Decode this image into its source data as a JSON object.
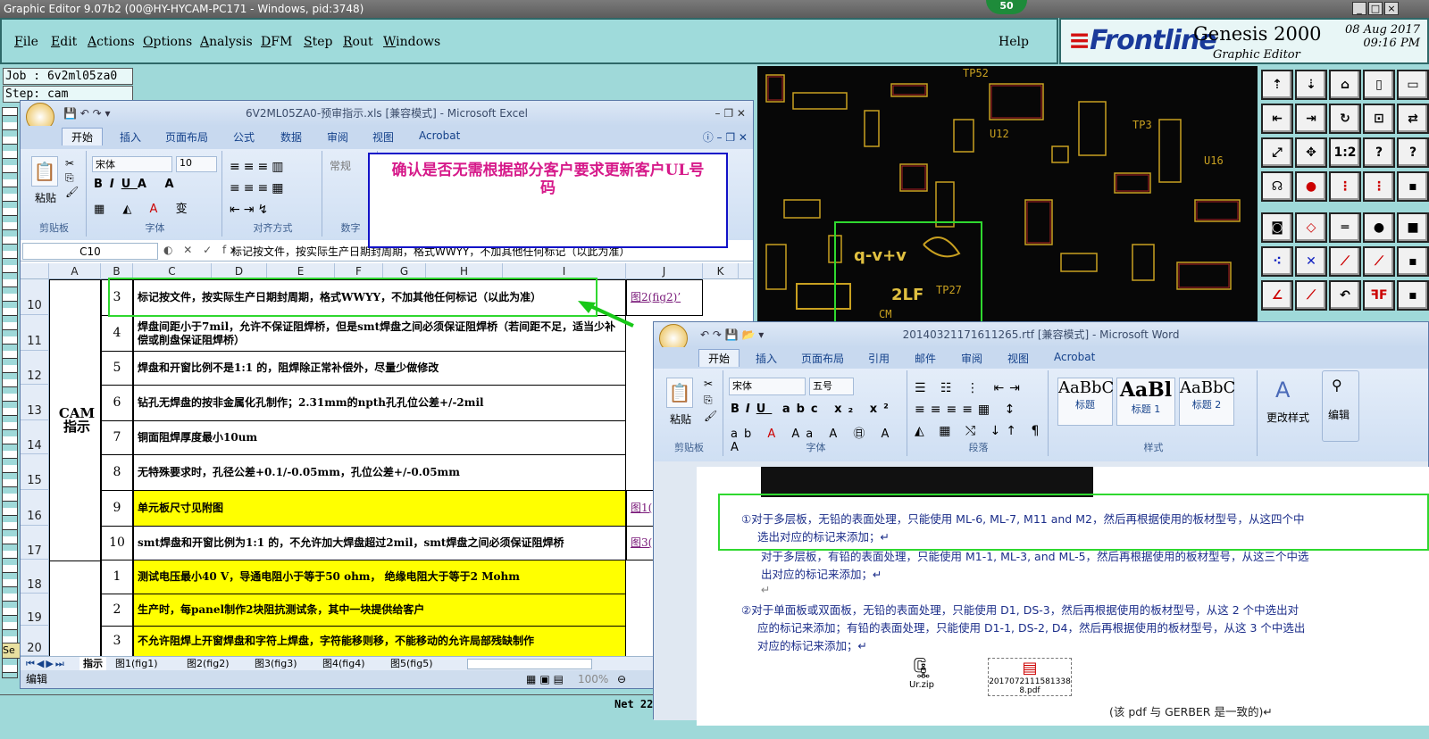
{
  "genesis": {
    "title": "Graphic Editor 9.07b2 (00@HY-HYCAM-PC171 - Windows, pid:3748)",
    "badge": "50",
    "menu": [
      {
        "label": "File",
        "u": "F",
        "rest": "ile"
      },
      {
        "label": "Edit",
        "u": "E",
        "rest": "dit"
      },
      {
        "label": "Actions",
        "u": "A",
        "rest": "ctions"
      },
      {
        "label": "Options",
        "u": "O",
        "rest": "ptions"
      },
      {
        "label": "Analysis",
        "u": "A",
        "rest": "nalysis"
      },
      {
        "label": "DFM",
        "u": "D",
        "rest": "FM"
      },
      {
        "label": "Step",
        "u": "S",
        "rest": "tep"
      },
      {
        "label": "Rout",
        "u": "R",
        "rest": "out"
      },
      {
        "label": "Windows",
        "u": "W",
        "rest": "indows"
      }
    ],
    "help": "Help",
    "logo_frontline": "Frontline",
    "product": "Genesis 2000",
    "subtitle": "Graphic Editor",
    "date": "08 Aug 2017",
    "time": "09:16 PM",
    "job": "Job : 6v2ml05za0",
    "step": "Step: cam",
    "net": "Net 22",
    "left_tab": "Se",
    "board_labels": [
      "TP52",
      "U12",
      "TP3",
      "U16",
      "TP27",
      "2LF",
      "q-v+v",
      "C100",
      "CM"
    ]
  },
  "excel": {
    "title": "6V2ML05ZA0-预审指示.xls  [兼容模式] - Microsoft Excel",
    "tabs": [
      "开始",
      "插入",
      "页面布局",
      "公式",
      "数据",
      "审阅",
      "视图",
      "Acrobat"
    ],
    "groups": {
      "clipboard": "剪贴板",
      "paste": "粘贴",
      "font": "字体",
      "font_name": "宋体",
      "font_size": "10",
      "alignment": "对齐方式",
      "number": "数字",
      "number_format": "常规"
    },
    "name_box": "C10",
    "formula": "标记按文件，按实际生产日期封周期，格式WWYY，不加其他任何标记（以此为准）",
    "columns": [
      "A",
      "B",
      "C",
      "D",
      "E",
      "F",
      "G",
      "H",
      "I",
      "J",
      "K"
    ],
    "section_label": "CAM\n指示",
    "rows": [
      {
        "row": "10",
        "n": "3",
        "text": "标记按文件，按实际生产日期封周期，格式WWYY，不加其他任何标记（以此为准）",
        "link": "图2(fig2)’",
        "yellow": false
      },
      {
        "row": "11",
        "n": "4",
        "text": "焊盘间距小于7mil，允许不保证阻焊桥，但是smt焊盘之间必须保证阻焊桥（若间距不足，适当少补偿或削盘保证阻焊桥）",
        "link": "",
        "yellow": false
      },
      {
        "row": "12",
        "n": "5",
        "text": "焊盘和开窗比例不是1:1 的，阻焊除正常补偿外，尽量少做修改",
        "link": "",
        "yellow": false
      },
      {
        "row": "13",
        "n": "6",
        "text": "钻孔无焊盘的按非金属化孔制作；2.31mm的npth孔孔位公差+/-2mil",
        "link": "",
        "yellow": false
      },
      {
        "row": "14",
        "n": "7",
        "text": "铜面阻焊厚度最小10um",
        "link": "",
        "yellow": false
      },
      {
        "row": "15",
        "n": "8",
        "text": "无特殊要求时，孔径公差+0.1/-0.05mm，孔位公差+/-0.05mm",
        "link": "",
        "yellow": false
      },
      {
        "row": "16",
        "n": "9",
        "text": "单元板尺寸见附图",
        "link": "图1(",
        "yellow": true
      },
      {
        "row": "17",
        "n": "10",
        "text": "smt焊盘和开窗比例为1:1 的，不允许加大焊盘超过2mil，smt焊盘之间必须保证阻焊桥",
        "link": "图3(",
        "yellow": false
      },
      {
        "row": "18",
        "n": "1",
        "text": "测试电压最小40 V，导通电阻小于等于50 ohm， 绝缘电阻大于等于2 Mohm",
        "link": "",
        "yellow": true
      },
      {
        "row": "19",
        "n": "2",
        "text": "生产时，每panel制作2块阻抗测试条，其中一块提供给客户",
        "link": "",
        "yellow": true
      },
      {
        "row": "20",
        "n": "3",
        "text": "不允许阻焊上开窗焊盘和字符上焊盘，字符能移则移，不能移动的允许局部残缺制作",
        "link": "",
        "yellow": true
      }
    ],
    "sheets": [
      "指示",
      "图1(fig1)",
      "图2(fig2)",
      "图3(fig3)",
      "图4(fig4)",
      "图5(fig5)"
    ],
    "status": "编辑",
    "zoom": "100%"
  },
  "callout": "确认是否无需根据部分客户要求更新客户UL号码",
  "word": {
    "title": "20140321171611265.rtf [兼容模式] - Microsoft Word",
    "tabs": [
      "开始",
      "插入",
      "页面布局",
      "引用",
      "邮件",
      "审阅",
      "视图",
      "Acrobat"
    ],
    "groups": {
      "clipboard": "剪贴板",
      "paste": "粘贴",
      "font": "字体",
      "font_name": "宋体",
      "font_size": "五号",
      "paragraph": "段落",
      "styles": "样式",
      "change_styles": "更改样式",
      "edit": "编辑"
    },
    "styles": [
      {
        "preview": "AaBbC",
        "name": "标题"
      },
      {
        "preview": "AaBl",
        "name": "标题 1"
      },
      {
        "preview": "AaBbC",
        "name": "标题 2"
      }
    ],
    "lines": [
      "①对于多层板，无铅的表面处理，只能使用 ML-6, ML-7, M11 and M2，然后再根据使用的板材型号，从这四个中",
      "选出对应的标记来添加；↵",
      "对于多层板，有铅的表面处理，只能使用 M1-1, ML-3, and ML-5，然后再根据使用的板材型号，从这三个中选",
      "出对应的标记来添加；↵",
      "↵",
      "②对于单面板或双面板，无铅的表面处理，只能使用 D1, DS-3，然后再根据使用的板材型号，从这 2 个中选出对",
      "应的标记来添加；有铅的表面处理，只能使用 D1-1, DS-2, D4，然后再根据使用的板材型号，从这 3 个中选出",
      "对应的标记来添加；↵"
    ],
    "attachment_zip": "Ur.zip",
    "attachment_pdf": "20170721115813388.pdf",
    "note": "(该 pdf 与 GERBER 是一致的)↵"
  }
}
